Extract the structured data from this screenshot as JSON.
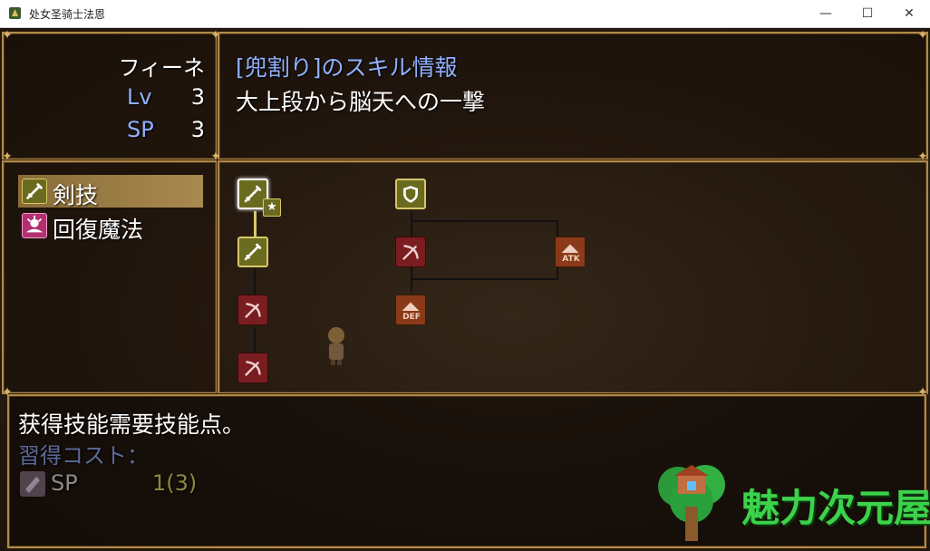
{
  "window": {
    "title": "处女圣骑士法恩",
    "minimize": "—",
    "maximize": "☐",
    "close": "✕"
  },
  "status": {
    "name": "フィーネ",
    "lv_label": "Lv",
    "lv_value": "3",
    "sp_label": "SP",
    "sp_value": "3"
  },
  "skill_info": {
    "title": "[兜割り]のスキル情報",
    "description": "大上段から脳天への一撃"
  },
  "categories": [
    {
      "label": "剣技",
      "icon": "sword-icon",
      "selected": true
    },
    {
      "label": "回復魔法",
      "icon": "heal-magic-icon",
      "selected": false
    }
  ],
  "tree_nodes": {
    "atk_label": "ATK",
    "def_label": "DEF"
  },
  "message": {
    "line1": "获得技能需要技能点。",
    "cost_label": "習得コスト：",
    "sp_label": "SP",
    "sp_cost": "1(3)"
  },
  "watermark": "魅力次元屋",
  "colors": {
    "frame": "#b08a4a",
    "selected_highlight": "#9a7a40",
    "learned_node": "#6b6b20",
    "locked_node": "#7a1d20",
    "stat_node": "#8a3a18",
    "blue_text": "#8fb0ff",
    "watermark_green": "#3cd24a"
  }
}
